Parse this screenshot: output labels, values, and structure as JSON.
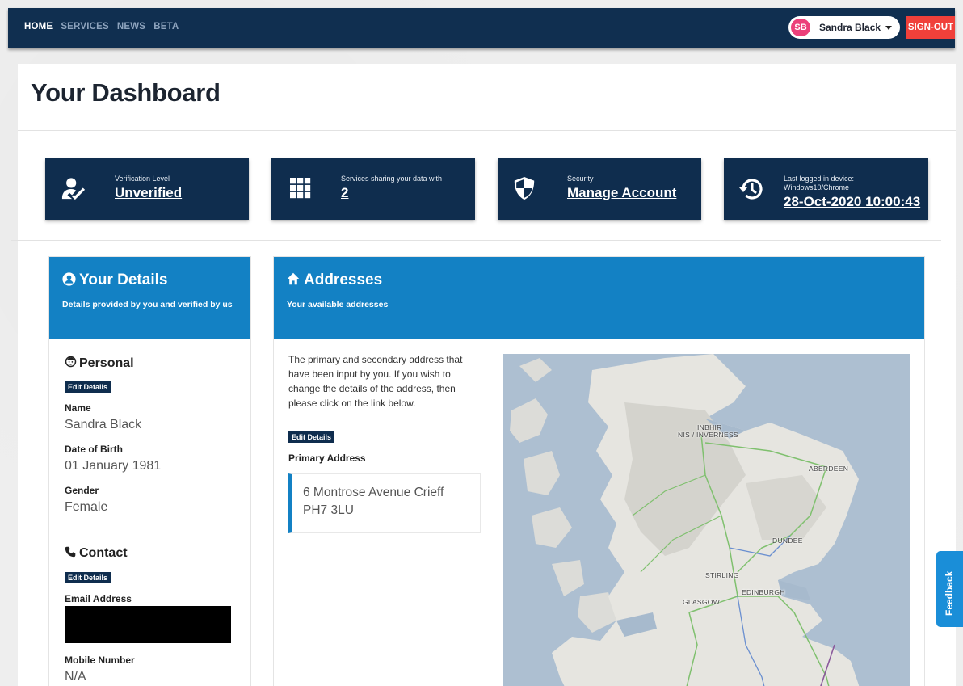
{
  "nav": {
    "links": [
      "HOME",
      "SERVICES",
      "NEWS",
      "BETA"
    ],
    "user": {
      "initials": "SB",
      "name": "Sandra Black"
    },
    "signout_label": "SIGN-OUT"
  },
  "page": {
    "title": "Your Dashboard"
  },
  "tiles": {
    "verification": {
      "label": "Verification Level",
      "value": "Unverified",
      "icon": "user-check-icon"
    },
    "services": {
      "label": "Services sharing your data with",
      "value": "2",
      "icon": "grid-icon"
    },
    "security": {
      "label": "Security",
      "value": "Manage Account",
      "icon": "shield-icon"
    },
    "last_login": {
      "label": "Last logged in device:",
      "device": "Windows10/Chrome",
      "value": "28-Oct-2020 10:00:43",
      "icon": "history-icon"
    }
  },
  "details": {
    "title": "Your Details",
    "subtitle": "Details provided by you and verified by us",
    "personal": {
      "title": "Personal",
      "edit_label": "Edit Details",
      "name_label": "Name",
      "name_value": "Sandra Black",
      "dob_label": "Date of Birth",
      "dob_value": "01 January 1981",
      "gender_label": "Gender",
      "gender_value": "Female"
    },
    "contact": {
      "title": "Contact",
      "edit_label": "Edit Details",
      "email_label": "Email Address",
      "mobile_label": "Mobile Number",
      "mobile_value": "N/A"
    }
  },
  "addresses": {
    "title": "Addresses",
    "subtitle": "Your available addresses",
    "description": "The primary and secondary address that have been input by you. If you wish to change the details of the address, then please click on the link below.",
    "edit_label": "Edit Details",
    "primary_label": "Primary Address",
    "primary_line1": "6 Montrose Avenue Crieff",
    "primary_line2": "PH7 3LU",
    "map_labels": {
      "inverness1": "INBHIR",
      "inverness2": "NIS / INVERNESS",
      "aberdeen": "ABERDEEN",
      "dundee": "DUNDEE",
      "stirling": "STIRLING",
      "edinburgh": "EDINBURGH",
      "glasgow": "GLASGOW"
    }
  },
  "feedback_label": "Feedback",
  "colors": {
    "navy": "#0f2d4e",
    "blue": "#1381c4",
    "signout": "#f0403a",
    "avatar": "#ec407a"
  }
}
